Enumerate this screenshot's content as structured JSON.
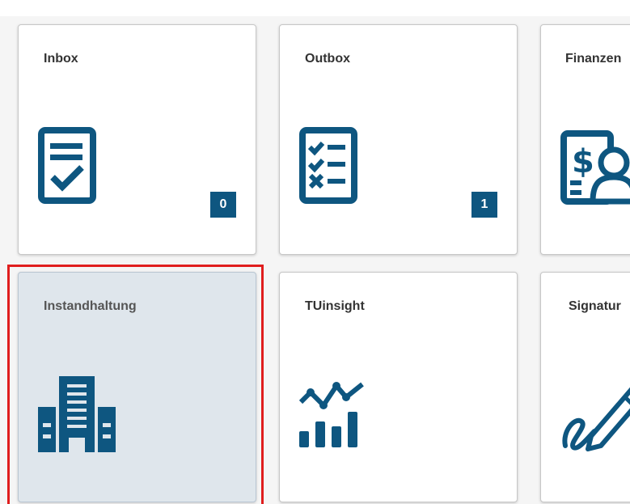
{
  "tiles": [
    {
      "title": "Inbox",
      "icon": "checklist-clipboard-icon",
      "count": "0"
    },
    {
      "title": "Outbox",
      "icon": "task-list-icon",
      "count": "1"
    },
    {
      "title": "Finanzen",
      "icon": "finance-person-icon"
    },
    {
      "title": "Instandhaltung",
      "icon": "building-icon",
      "selected": true
    },
    {
      "title": "TUinsight",
      "icon": "analytics-chart-icon"
    },
    {
      "title": "Signatur",
      "icon": "signature-pen-icon"
    }
  ],
  "colors": {
    "icon": "#0e5680",
    "badge": "#0e5680",
    "selected_background": "#dfe6ec",
    "focus_outline": "#e01e1e"
  }
}
